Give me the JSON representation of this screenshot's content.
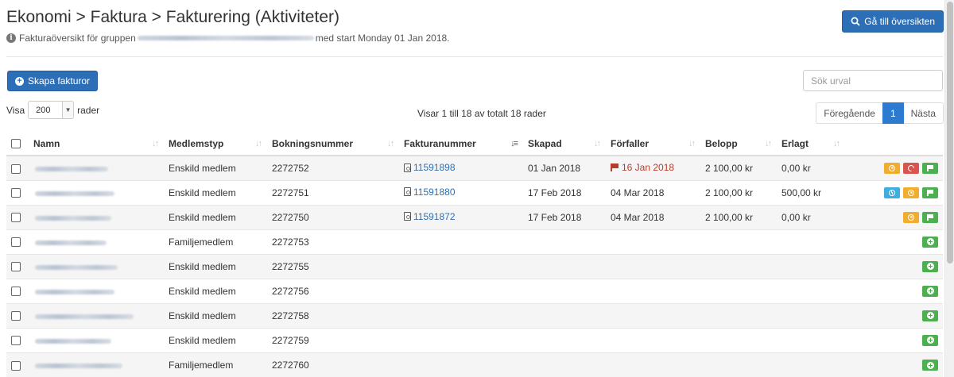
{
  "page": {
    "title": "Ekonomi > Faktura > Fakturering (Aktiviteter)",
    "subtitle_prefix": "Fakturaöversikt för gruppen",
    "subtitle_suffix": "med start Monday 01 Jan 2018.",
    "overview_button": "Gå till översikten"
  },
  "toolbar": {
    "create_button": "Skapa fakturor",
    "search_placeholder": "Sök urval",
    "show_label": "Visa",
    "page_size": "200",
    "rows_label": "rader",
    "info": "Visar 1 till 18 av totalt 18 rader",
    "pagination": {
      "prev": "Föregående",
      "current": "1",
      "next": "Nästa"
    }
  },
  "table": {
    "columns": [
      "Namn",
      "Medlemstyp",
      "Bokningsnummer",
      "Fakturanummer",
      "Skapad",
      "Förfaller",
      "Belopp",
      "Erlagt"
    ],
    "rows": [
      {
        "type": "Enskild medlem",
        "booking": "2272752",
        "invoice": "11591898",
        "created": "01 Jan 2018",
        "due": "16 Jan 2018",
        "overdue": true,
        "amount": "2 100,00 kr",
        "paid": "0,00 kr",
        "actions": [
          "cancel",
          "undo",
          "flag"
        ]
      },
      {
        "type": "Enskild medlem",
        "booking": "2272751",
        "invoice": "11591880",
        "created": "17 Feb 2018",
        "due": "04 Mar 2018",
        "overdue": false,
        "amount": "2 100,00 kr",
        "paid": "500,00 kr",
        "actions": [
          "clock",
          "cancel",
          "flag"
        ]
      },
      {
        "type": "Enskild medlem",
        "booking": "2272750",
        "invoice": "11591872",
        "created": "17 Feb 2018",
        "due": "04 Mar 2018",
        "overdue": false,
        "amount": "2 100,00 kr",
        "paid": "0,00 kr",
        "actions": [
          "cancel",
          "flag"
        ]
      },
      {
        "type": "Familjemedlem",
        "booking": "2272753",
        "invoice": "",
        "created": "",
        "due": "",
        "overdue": false,
        "amount": "",
        "paid": "",
        "actions": [
          "add"
        ]
      },
      {
        "type": "Enskild medlem",
        "booking": "2272755",
        "invoice": "",
        "created": "",
        "due": "",
        "overdue": false,
        "amount": "",
        "paid": "",
        "actions": [
          "add"
        ]
      },
      {
        "type": "Enskild medlem",
        "booking": "2272756",
        "invoice": "",
        "created": "",
        "due": "",
        "overdue": false,
        "amount": "",
        "paid": "",
        "actions": [
          "add"
        ]
      },
      {
        "type": "Enskild medlem",
        "booking": "2272758",
        "invoice": "",
        "created": "",
        "due": "",
        "overdue": false,
        "amount": "",
        "paid": "",
        "actions": [
          "add"
        ]
      },
      {
        "type": "Enskild medlem",
        "booking": "2272759",
        "invoice": "",
        "created": "",
        "due": "",
        "overdue": false,
        "amount": "",
        "paid": "",
        "actions": [
          "add"
        ]
      },
      {
        "type": "Familjemedlem",
        "booking": "2272760",
        "invoice": "",
        "created": "",
        "due": "",
        "overdue": false,
        "amount": "",
        "paid": "",
        "actions": [
          "add"
        ]
      }
    ]
  },
  "colors": {
    "primary": "#2d6fb6",
    "link": "#2e6fb0",
    "overdue": "#b73c2c",
    "action_orange": "#f0ad2e",
    "action_red": "#d9534f",
    "action_green": "#4caf50",
    "action_blue": "#3eaee0"
  }
}
